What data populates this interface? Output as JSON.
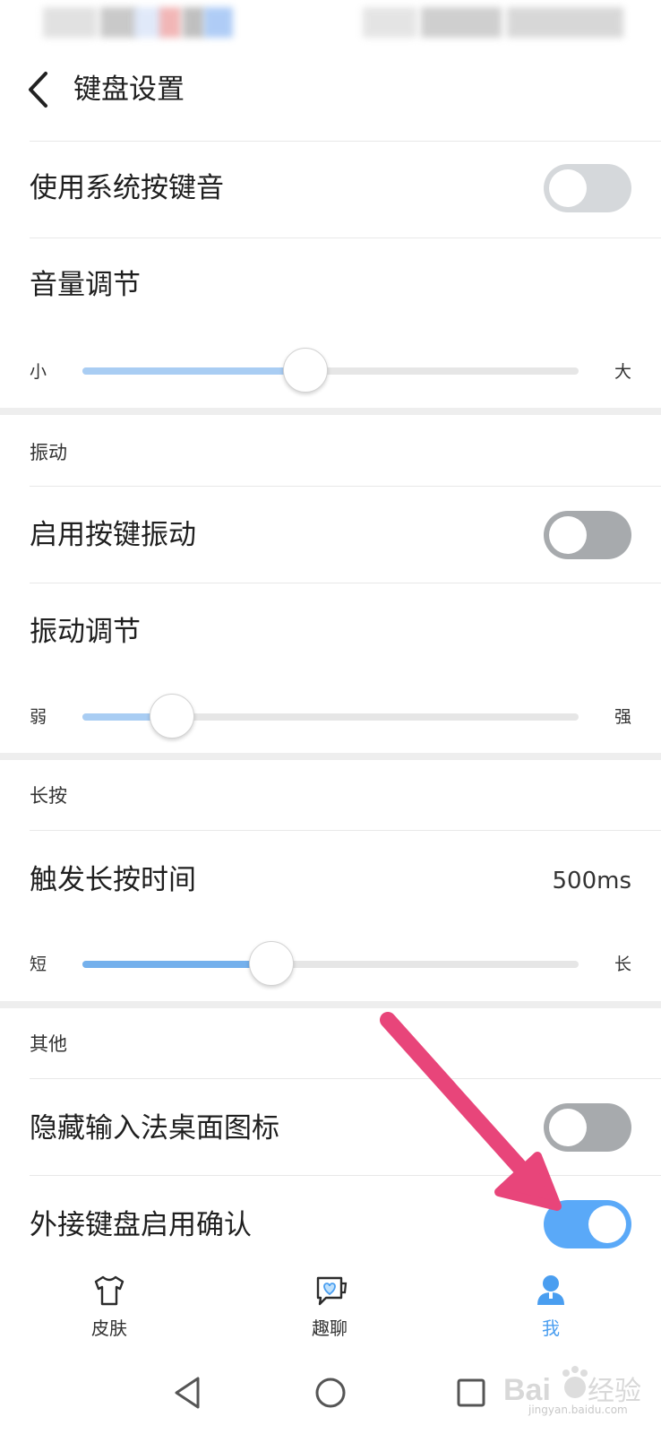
{
  "header": {
    "title": "键盘设置"
  },
  "rows": {
    "system_key_sound": {
      "label": "使用系统按键音",
      "enabled": false
    },
    "volume": {
      "label": "音量调节",
      "min_label": "小",
      "max_label": "大",
      "level": 0.45
    },
    "vibration_section": {
      "title": "振动"
    },
    "key_vibration": {
      "label": "启用按键振动",
      "enabled": false
    },
    "vibration_level": {
      "label": "振动调节",
      "min_label": "弱",
      "max_label": "强",
      "level": 0.18
    },
    "long_press_section": {
      "title": "长按"
    },
    "long_press_time": {
      "label": "触发长按时间",
      "value": "500ms",
      "min_label": "短",
      "max_label": "长",
      "level": 0.38
    },
    "other_section": {
      "title": "其他"
    },
    "hide_icon": {
      "label": "隐藏输入法桌面图标",
      "enabled": false
    },
    "external_keyboard": {
      "label": "外接键盘启用确认",
      "enabled": true
    }
  },
  "bottom_nav": {
    "items": [
      {
        "label": "皮肤",
        "icon": "tshirt-icon",
        "active": false
      },
      {
        "label": "趣聊",
        "icon": "chat-heart-icon",
        "active": false
      },
      {
        "label": "我",
        "icon": "person-icon",
        "active": true
      }
    ]
  },
  "watermark": {
    "text": "jingyan.baidu.com"
  },
  "colors": {
    "accent": "#5aa9f8",
    "slider_fill": "#a9cdf3",
    "slider_fill_strong": "#74b0ec",
    "annotation_arrow": "#e8457a",
    "toggle_off_light": "#d5d8db",
    "toggle_off_dark": "#a7aaad"
  }
}
